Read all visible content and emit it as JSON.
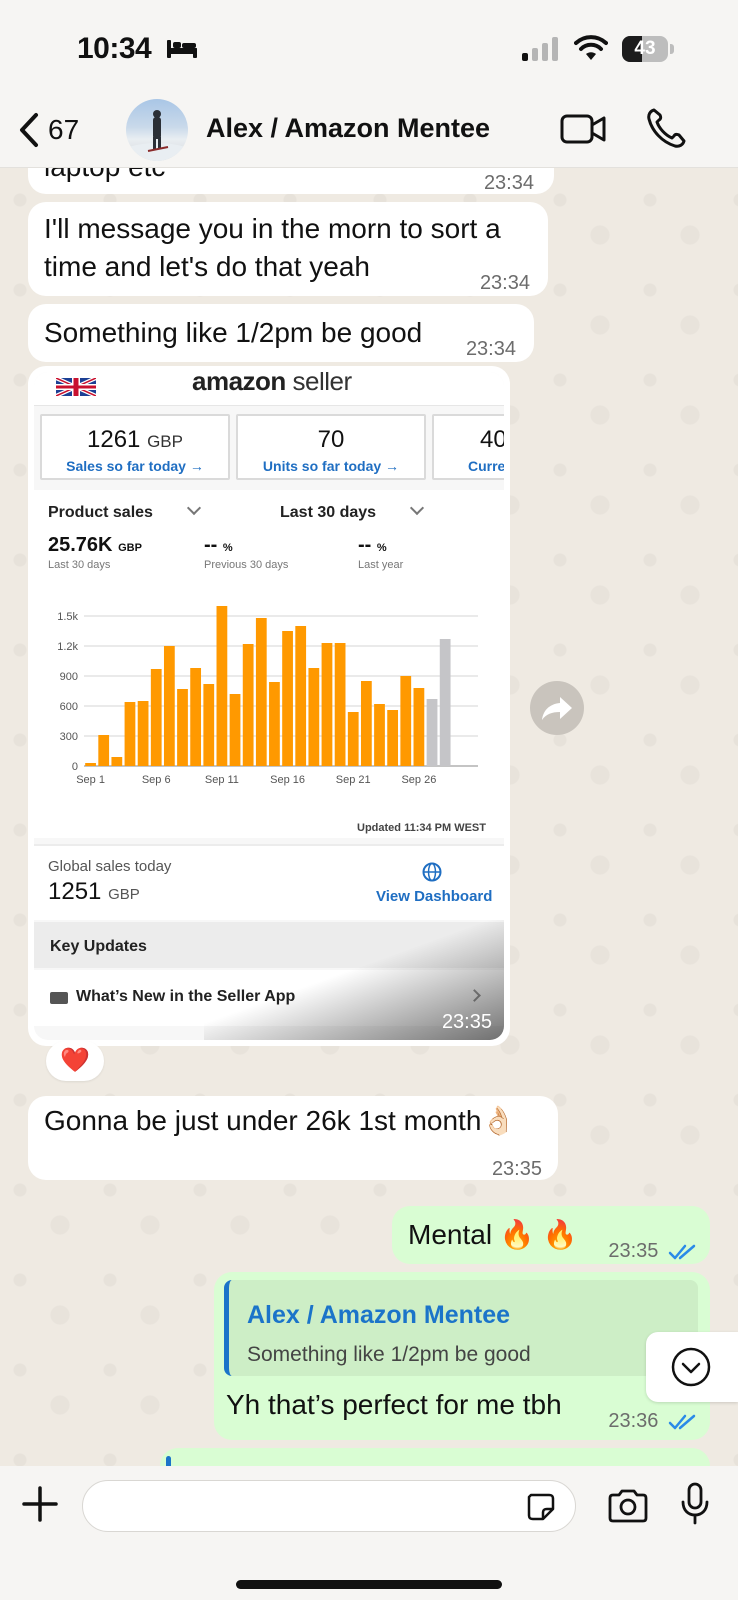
{
  "status_bar": {
    "time": "10:34",
    "battery": "43",
    "battery_level": 0.43
  },
  "header": {
    "back_count": "67",
    "contact_name": "Alex / Amazon Mentee"
  },
  "messages": [
    {
      "type": "incoming",
      "text": "laptop etc",
      "time": "23:34"
    },
    {
      "type": "incoming",
      "text_line1": "I'll message you in the morn to sort a",
      "text_line2": "time and let's do that yeah",
      "time": "23:34"
    },
    {
      "type": "incoming",
      "text": "Something like 1/2pm be good",
      "time": "23:34"
    },
    {
      "type": "incoming-image",
      "time": "23:35",
      "reaction": "❤️"
    },
    {
      "type": "incoming",
      "text": "Gonna be just under 26k 1st month👌🏻",
      "time": "23:35"
    },
    {
      "type": "outgoing",
      "text": "Mental 🔥 🔥",
      "time": "23:35"
    },
    {
      "type": "outgoing-reply",
      "reply_to_name": "Alex / Amazon Mentee",
      "reply_to_text": "Something like 1/2pm be good",
      "text": "Yh that’s perfect for me tbh",
      "time": "23:36"
    }
  ],
  "screenshot": {
    "logo_main": "amazon",
    "logo_sub": "seller",
    "kpis": [
      {
        "value": "1261",
        "unit": "GBP",
        "label": "Sales so far today →"
      },
      {
        "value": "70",
        "unit": "",
        "label": "Units so far today →"
      },
      {
        "value": "40",
        "unit": "",
        "label": "Curre"
      }
    ],
    "selector_left": "Product sales",
    "selector_right": "Last 30 days",
    "stats": [
      {
        "value": "25.76K",
        "unit": "GBP",
        "label": "Last 30 days"
      },
      {
        "value": "--",
        "unit": "%",
        "label": "Previous 30 days"
      },
      {
        "value": "--",
        "unit": "%",
        "label": "Last year"
      }
    ],
    "updated": "Updated 11:34 PM WEST",
    "global_label": "Global sales today",
    "global_value": "1251",
    "global_unit": "GBP",
    "view_dashboard": "View Dashboard",
    "key_updates": "Key Updates",
    "news_item": "What’s New in the Seller App"
  },
  "chart_data": {
    "type": "bar",
    "categories": [
      "Sep 1",
      "Sep 2",
      "Sep 3",
      "Sep 4",
      "Sep 5",
      "Sep 6",
      "Sep 7",
      "Sep 8",
      "Sep 9",
      "Sep 10",
      "Sep 11",
      "Sep 12",
      "Sep 13",
      "Sep 14",
      "Sep 15",
      "Sep 16",
      "Sep 17",
      "Sep 18",
      "Sep 19",
      "Sep 20",
      "Sep 21",
      "Sep 22",
      "Sep 23",
      "Sep 24",
      "Sep 25",
      "Sep 26",
      "Sep 27",
      "Sep 28",
      "Sep 29",
      "Sep 30"
    ],
    "values": [
      30,
      310,
      90,
      640,
      650,
      970,
      1200,
      770,
      980,
      820,
      1600,
      720,
      1220,
      1480,
      840,
      1350,
      1400,
      980,
      1230,
      1230,
      540,
      850,
      620,
      560,
      900,
      780,
      670,
      1270,
      0,
      0
    ],
    "highlight_colors": {
      "normal": "#ff9900",
      "partial": "#c5c5c8"
    },
    "partial_days": [
      26,
      27
    ],
    "xtick_labels": [
      "Sep 1",
      "Sep 6",
      "Sep 11",
      "Sep 16",
      "Sep 21",
      "Sep 26"
    ],
    "ytick_labels": [
      "0",
      "300",
      "600",
      "900",
      "1.2k",
      "1.5k"
    ],
    "ylim": [
      0,
      1600
    ],
    "grid": true
  },
  "composer": {
    "placeholder": ""
  },
  "colors": {
    "accent": "#1b74c9",
    "incoming": "#ffffff",
    "outgoing": "#d9fdd3",
    "bar": "#ff9900"
  }
}
